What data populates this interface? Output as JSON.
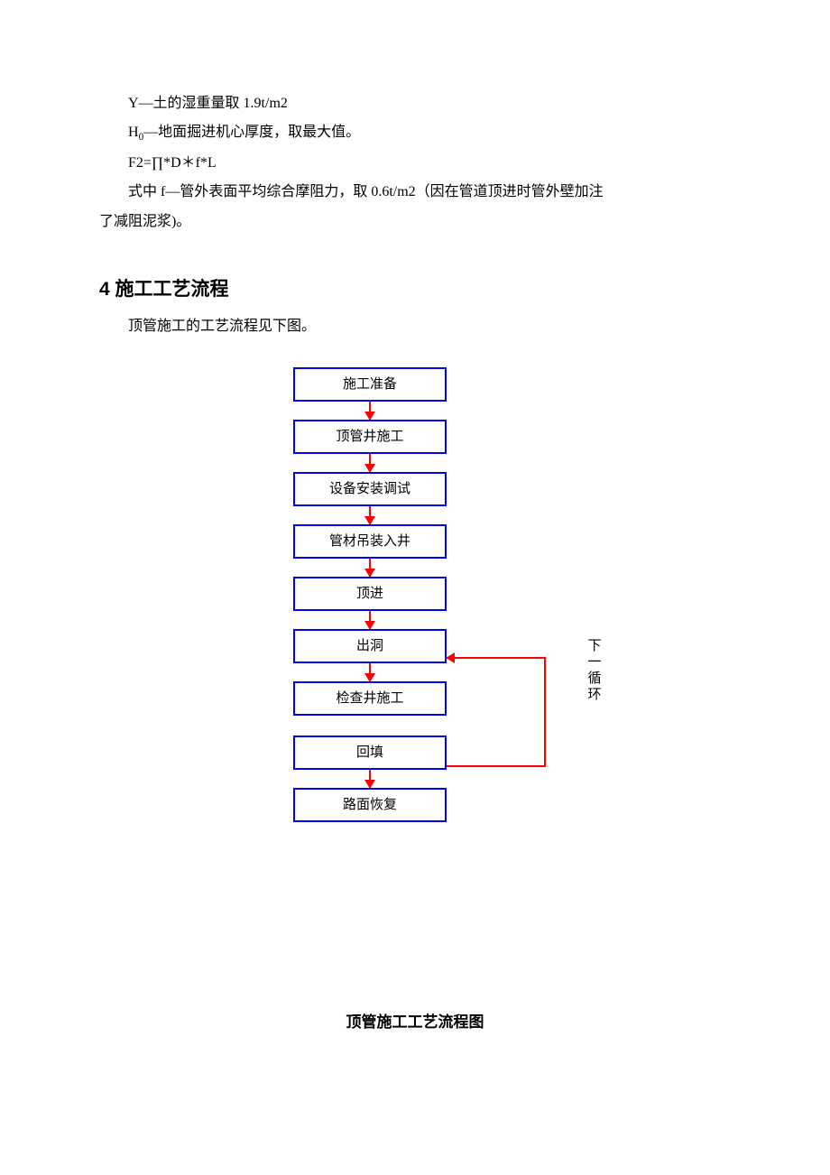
{
  "text": {
    "p1": "Y—土的湿重量取 1.9t/m2",
    "p2_a": "H",
    "p2_sub": "0",
    "p2_b": "—地面掘进机心厚度，取最大值。",
    "p3": "F2=∏*D＊f*L",
    "p4": "式中 f—管外表面平均综合摩阻力，取 0.6t/m2（因在管道顶进时管外壁加注",
    "p5": "了减阻泥浆)。"
  },
  "section": {
    "num": "4",
    "title": "施工工艺流程",
    "intro": "顶管施工的工艺流程见下图。"
  },
  "flow": {
    "steps": {
      "s1": "施工准备",
      "s2": "顶管井施工",
      "s3": "设备安装调试",
      "s4": "管材吊装入井",
      "s5": "顶进",
      "s6": "出洞",
      "s7": "检查井施工",
      "s8": "回填",
      "s9": "路面恢复"
    },
    "loop_label": "下一循环",
    "caption": "顶管施工工艺流程图"
  }
}
